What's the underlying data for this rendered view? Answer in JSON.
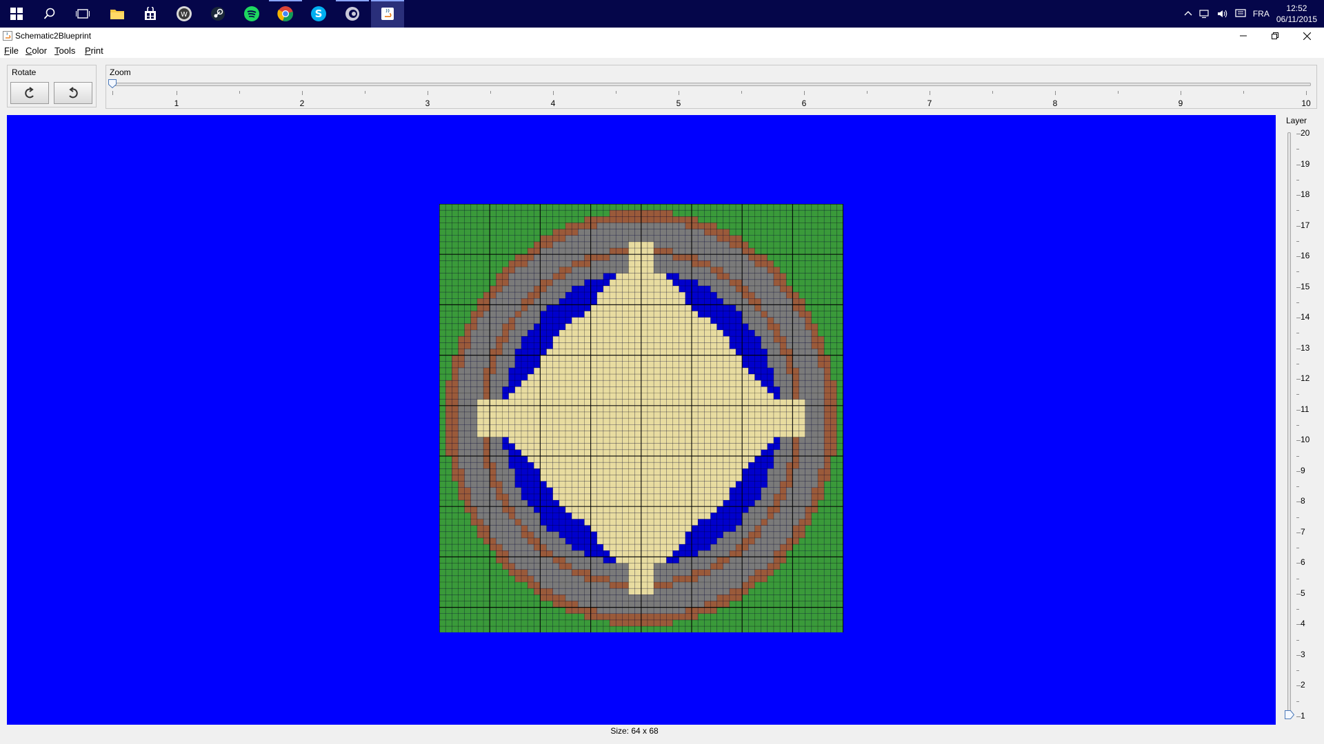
{
  "taskbar": {
    "apps": [
      {
        "name": "start",
        "icon": "windows-logo-icon"
      },
      {
        "name": "search",
        "icon": "search-icon"
      },
      {
        "name": "task-view",
        "icon": "task-view-icon"
      },
      {
        "name": "file-explorer",
        "icon": "folder-icon"
      },
      {
        "name": "store",
        "icon": "store-icon"
      },
      {
        "name": "app-icon-5",
        "icon": "badge-icon"
      },
      {
        "name": "steam",
        "icon": "steam-icon"
      },
      {
        "name": "spotify",
        "icon": "spotify-icon"
      },
      {
        "name": "chrome",
        "icon": "chrome-icon"
      },
      {
        "name": "skype",
        "icon": "skype-icon"
      },
      {
        "name": "app-icon-10",
        "icon": "media-icon"
      },
      {
        "name": "java",
        "icon": "java-icon"
      }
    ],
    "language": "FRA",
    "time": "12:52",
    "date": "06/11/2015"
  },
  "window": {
    "title": "Schematic2Blueprint",
    "minimize": "—",
    "maximize": "❐",
    "close": "✕"
  },
  "menu": {
    "file": "File",
    "color": "Color",
    "tools": "Tools",
    "print": "Print"
  },
  "rotate": {
    "label": "Rotate",
    "left_icon": "rotate-left-icon",
    "right_icon": "rotate-right-icon"
  },
  "zoom": {
    "label": "Zoom",
    "ticks": [
      "1",
      "2",
      "3",
      "4",
      "5",
      "6",
      "7",
      "8",
      "9",
      "10"
    ],
    "value": 1
  },
  "layer": {
    "label": "Layer",
    "ticks": [
      "20",
      "19",
      "18",
      "17",
      "16",
      "15",
      "14",
      "13",
      "12",
      "11",
      "10",
      "9",
      "8",
      "7",
      "6",
      "5",
      "4",
      "3",
      "2",
      "1"
    ],
    "value": 1
  },
  "status": {
    "size": "Size: 64 x 68"
  },
  "colors": {
    "background": "#0000ff",
    "grass": "#3a9a3a",
    "dirt": "#9a5a3a",
    "stone": "#7a7a7a",
    "water": "#0000cc",
    "sand": "#e8dca0",
    "taskbar": "#05064a"
  },
  "blueprint": {
    "cols": 64,
    "rows": 68
  }
}
